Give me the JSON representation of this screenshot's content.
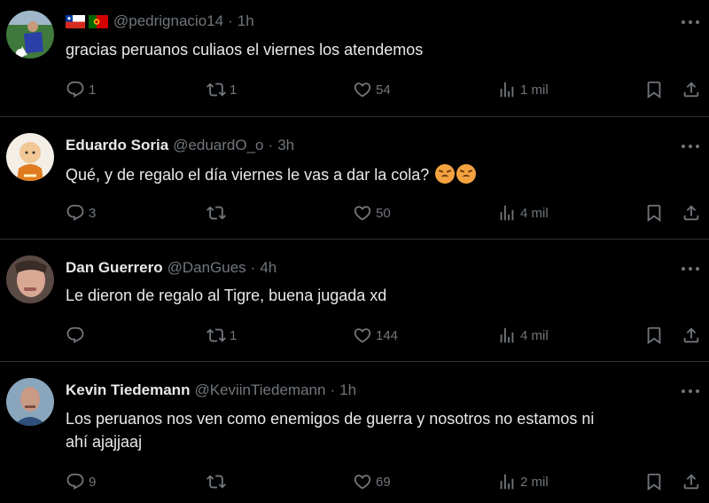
{
  "tweets": [
    {
      "name": "",
      "handle": "@pedrignacio14",
      "time": "1h",
      "text": "gracias peruanos culiaos el viernes los atendemos",
      "replies": "1",
      "retweets": "1",
      "likes": "54",
      "views": "1 mil",
      "flags": [
        "chile-flag",
        "portugal-flag"
      ]
    },
    {
      "name": "Eduardo Soria",
      "handle": "@eduardO_o",
      "time": "3h",
      "text": "Qué, y de regalo el día viernes le vas a dar la cola?",
      "replies": "3",
      "retweets": "",
      "likes": "50",
      "views": "4 mil",
      "emojis": [
        "angry-face-emoji",
        "angry-face-emoji"
      ]
    },
    {
      "name": "Dan Guerrero",
      "handle": "@DanGues",
      "time": "4h",
      "text": "Le dieron de regalo al Tigre, buena jugada xd",
      "replies": "",
      "retweets": "1",
      "likes": "144",
      "views": "4 mil"
    },
    {
      "name": "Kevin Tiedemann",
      "handle": "@KeviinTiedemann",
      "time": "1h",
      "text_line1": "Los peruanos nos ven como enemigos de guerra y nosotros no estamos ni",
      "text_line2": "ahí ajajjaaj",
      "replies": "9",
      "retweets": "",
      "likes": "69",
      "views": "2 mil"
    }
  ],
  "colors": {
    "background": "#000000",
    "text": "#e7e9ea",
    "secondary": "#71767b",
    "divider": "#2f3336"
  }
}
